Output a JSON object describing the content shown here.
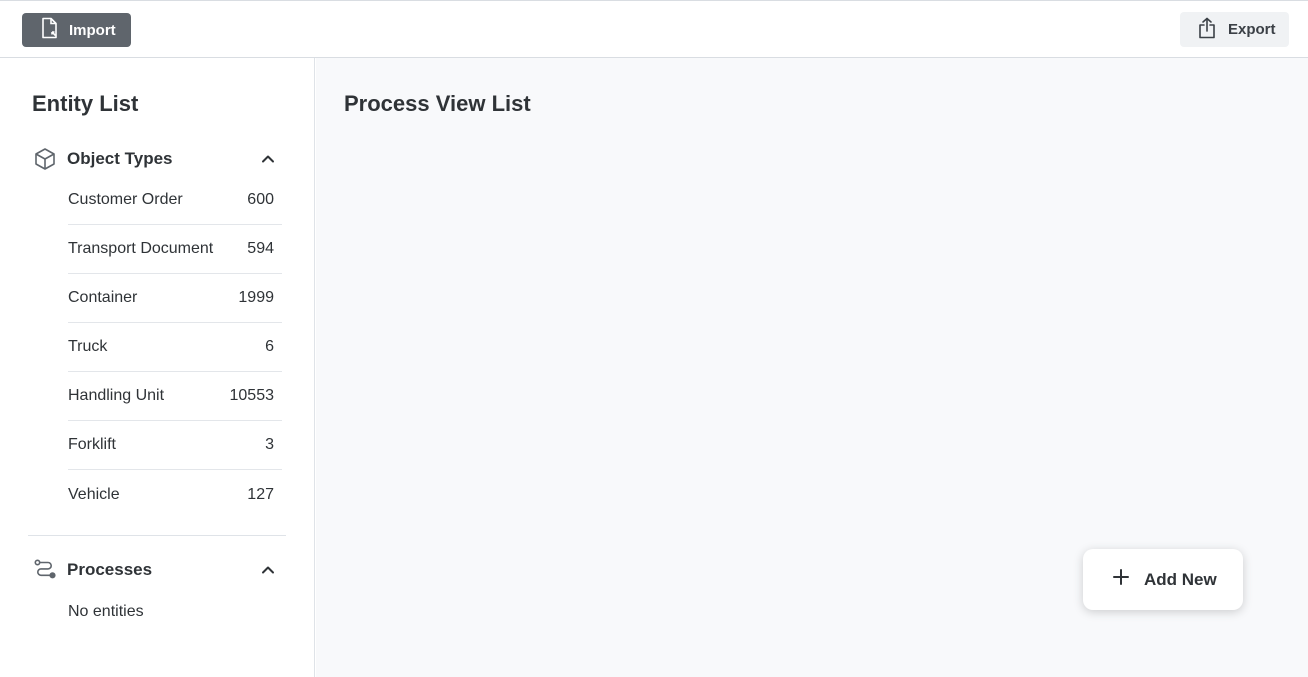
{
  "toolbar": {
    "import_label": "Import",
    "export_label": "Export",
    "import_bg": "#5f656c",
    "export_bg": "#f0f2f4"
  },
  "sidebar": {
    "title": "Entity List",
    "object_types": {
      "label": "Object Types",
      "icon": "cube-icon",
      "items": [
        {
          "label": "Customer Order",
          "count": "600"
        },
        {
          "label": "Transport Document",
          "count": "594"
        },
        {
          "label": "Container",
          "count": "1999"
        },
        {
          "label": "Truck",
          "count": "6"
        },
        {
          "label": "Handling Unit",
          "count": "10553"
        },
        {
          "label": "Forklift",
          "count": "3"
        },
        {
          "label": "Vehicle",
          "count": "127"
        }
      ]
    },
    "processes": {
      "label": "Processes",
      "icon": "route-icon",
      "empty_text": "No entities"
    }
  },
  "main": {
    "title": "Process View List",
    "add_label": "Add New"
  }
}
